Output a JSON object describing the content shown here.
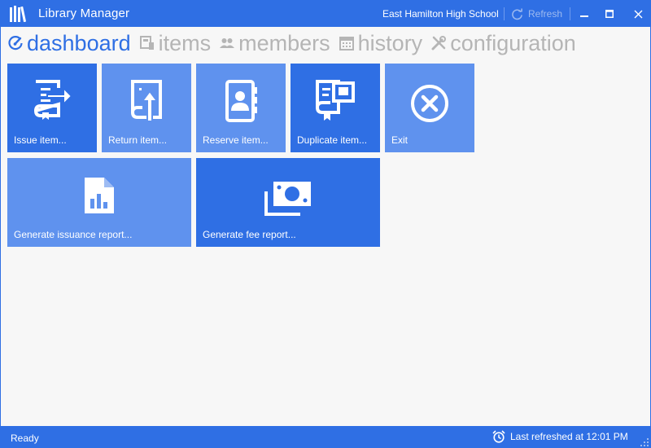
{
  "window": {
    "title": "Library Manager",
    "school": "East Hamilton High School",
    "refresh_label": "Refresh"
  },
  "nav": {
    "items": [
      {
        "label": "dashboard",
        "icon": "gauge-icon",
        "active": true
      },
      {
        "label": "items",
        "icon": "book-card-icon",
        "active": false
      },
      {
        "label": "members",
        "icon": "people-icon",
        "active": false
      },
      {
        "label": "history",
        "icon": "calendar-icon",
        "active": false
      },
      {
        "label": "configuration",
        "icon": "tools-icon",
        "active": false
      }
    ]
  },
  "tiles": [
    {
      "label": "Issue item...",
      "icon": "book-issue-icon"
    },
    {
      "label": "Return item...",
      "icon": "book-return-icon"
    },
    {
      "label": "Reserve item...",
      "icon": "contact-book-icon"
    },
    {
      "label": "Duplicate item...",
      "icon": "book-duplicate-icon"
    },
    {
      "label": "Exit",
      "icon": "close-circle-icon"
    },
    {
      "label": "Generate issuance report...",
      "icon": "report-chart-icon"
    },
    {
      "label": "Generate fee report...",
      "icon": "money-icon"
    }
  ],
  "status": {
    "text": "Ready",
    "last_refreshed": "Last refreshed at 12:01 PM"
  },
  "colors": {
    "accent": "#2f6fe4",
    "tile_light": "#5f92ee",
    "nav_inactive": "#b5b5b5",
    "background": "#f7f7f7"
  }
}
